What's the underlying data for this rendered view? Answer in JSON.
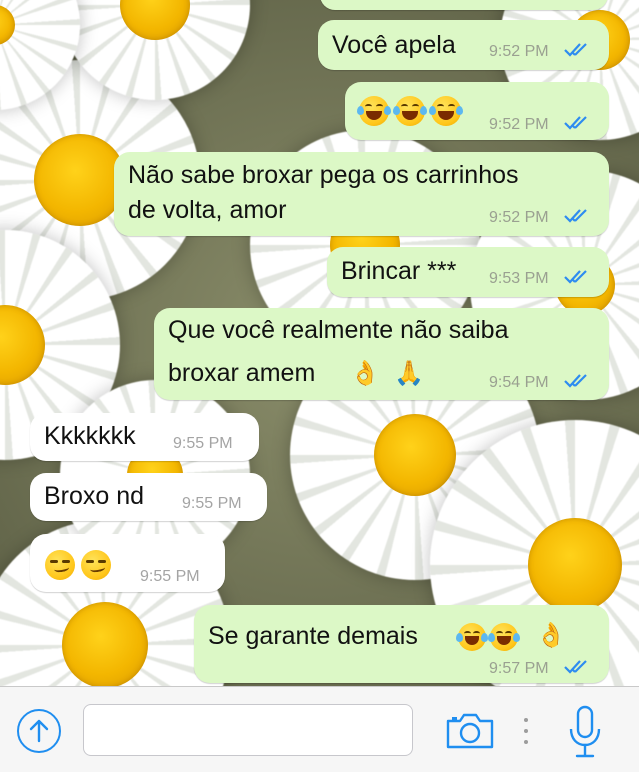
{
  "colors": {
    "outgoing_bubble": "#dcf8c6",
    "incoming_bubble": "#ffffff",
    "read_ticks": "#2e8cf0",
    "accent": "#1f8ef0"
  },
  "messages": [
    {
      "direction": "outgoing",
      "text": "Você apela",
      "time": "9:52 PM",
      "status": "read"
    },
    {
      "direction": "outgoing",
      "emoji": [
        "face-with-tears-of-joy",
        "face-with-tears-of-joy",
        "face-with-tears-of-joy"
      ],
      "time": "9:52 PM",
      "status": "read"
    },
    {
      "direction": "outgoing",
      "lines": [
        "Não sabe broxar pega os carrinhos",
        "de volta, amor"
      ],
      "time": "9:52 PM",
      "status": "read"
    },
    {
      "direction": "outgoing",
      "text": "Brincar ***",
      "time": "9:53 PM",
      "status": "read"
    },
    {
      "direction": "outgoing",
      "lines": [
        "Que você realmente não saiba",
        "broxar amem"
      ],
      "emoji": [
        "ok-hand",
        "folded-hands"
      ],
      "time": "9:54 PM",
      "status": "read"
    },
    {
      "direction": "incoming",
      "text": "Kkkkkkk",
      "time": "9:55 PM"
    },
    {
      "direction": "incoming",
      "text": "Broxo nd",
      "time": "9:55 PM"
    },
    {
      "direction": "incoming",
      "emoji": [
        "smirking-face",
        "smirking-face"
      ],
      "time": "9:55 PM"
    },
    {
      "direction": "outgoing",
      "text": "Se garante demais",
      "emoji": [
        "face-with-tears-of-joy",
        "face-with-tears-of-joy",
        "ok-hand"
      ],
      "time": "9:57 PM",
      "status": "read"
    }
  ],
  "input_bar": {
    "attach_icon": "arrow-up-circle-icon",
    "message_placeholder": "",
    "camera_icon": "camera-icon",
    "more_icon": "vertical-dots-icon",
    "mic_icon": "microphone-icon"
  }
}
